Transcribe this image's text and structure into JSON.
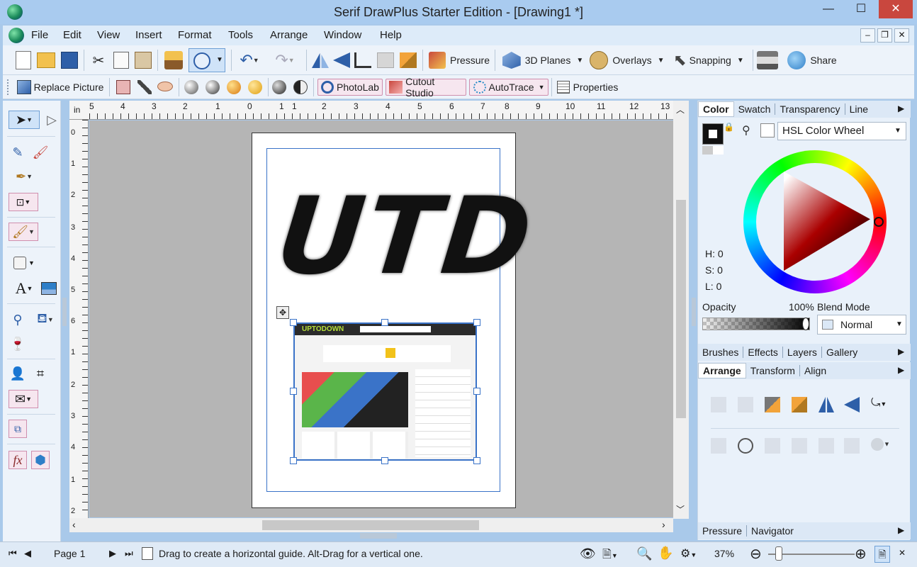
{
  "window": {
    "title": "Serif DrawPlus Starter Edition - [Drawing1 *]"
  },
  "title_controls": {
    "minimize": "—",
    "maximize": "☐",
    "close": "✕"
  },
  "menu": [
    "File",
    "Edit",
    "View",
    "Insert",
    "Format",
    "Tools",
    "Arrange",
    "Window",
    "Help"
  ],
  "mdi_controls": {
    "minimize": "–",
    "restore": "❐",
    "close": "✕"
  },
  "toolbar1": {
    "pressure": "Pressure",
    "planes": "3D Planes",
    "overlays": "Overlays",
    "snapping": "Snapping",
    "share": "Share"
  },
  "toolbar2": {
    "replace_picture": "Replace Picture",
    "photolab": "PhotoLab",
    "cutout": "Cutout Studio",
    "autotrace": "AutoTrace",
    "properties": "Properties"
  },
  "ruler": {
    "unit": "in",
    "h_ticks": [
      "5",
      "4",
      "3",
      "2",
      "1",
      "0",
      "1",
      "1",
      "2",
      "3",
      "4",
      "5",
      "6",
      "7",
      "8",
      "9",
      "10",
      "11",
      "12",
      "13"
    ],
    "v_ticks": [
      "0",
      "1",
      "2",
      "3",
      "4",
      "5",
      "6",
      "1",
      "2",
      "3",
      "4",
      "1",
      "2"
    ]
  },
  "drawing": {
    "text": "UTD",
    "thumb_logo": "UPTODOWN"
  },
  "color_panel": {
    "tabs": [
      "Color",
      "Swatch",
      "Transparency",
      "Line"
    ],
    "mode": "HSL Color Wheel",
    "h": "H: 0",
    "s": "S: 0",
    "l": "L: 0",
    "opacity_label": "Opacity",
    "opacity_value": "100%",
    "blend_label": "Blend Mode",
    "blend_value": "Normal"
  },
  "panel2": {
    "tabs": [
      "Brushes",
      "Effects",
      "Layers",
      "Gallery"
    ]
  },
  "panel3": {
    "tabs": [
      "Arrange",
      "Transform",
      "Align"
    ]
  },
  "panel4": {
    "tabs": [
      "Pressure",
      "Navigator"
    ]
  },
  "status": {
    "page": "Page 1",
    "hint": "Drag to create a horizontal guide. Alt-Drag for a vertical one.",
    "zoom": "37%"
  },
  "colors": {
    "accent": "#3a73c8",
    "title_bg": "#a9cbef",
    "close_red": "#c9473e"
  }
}
